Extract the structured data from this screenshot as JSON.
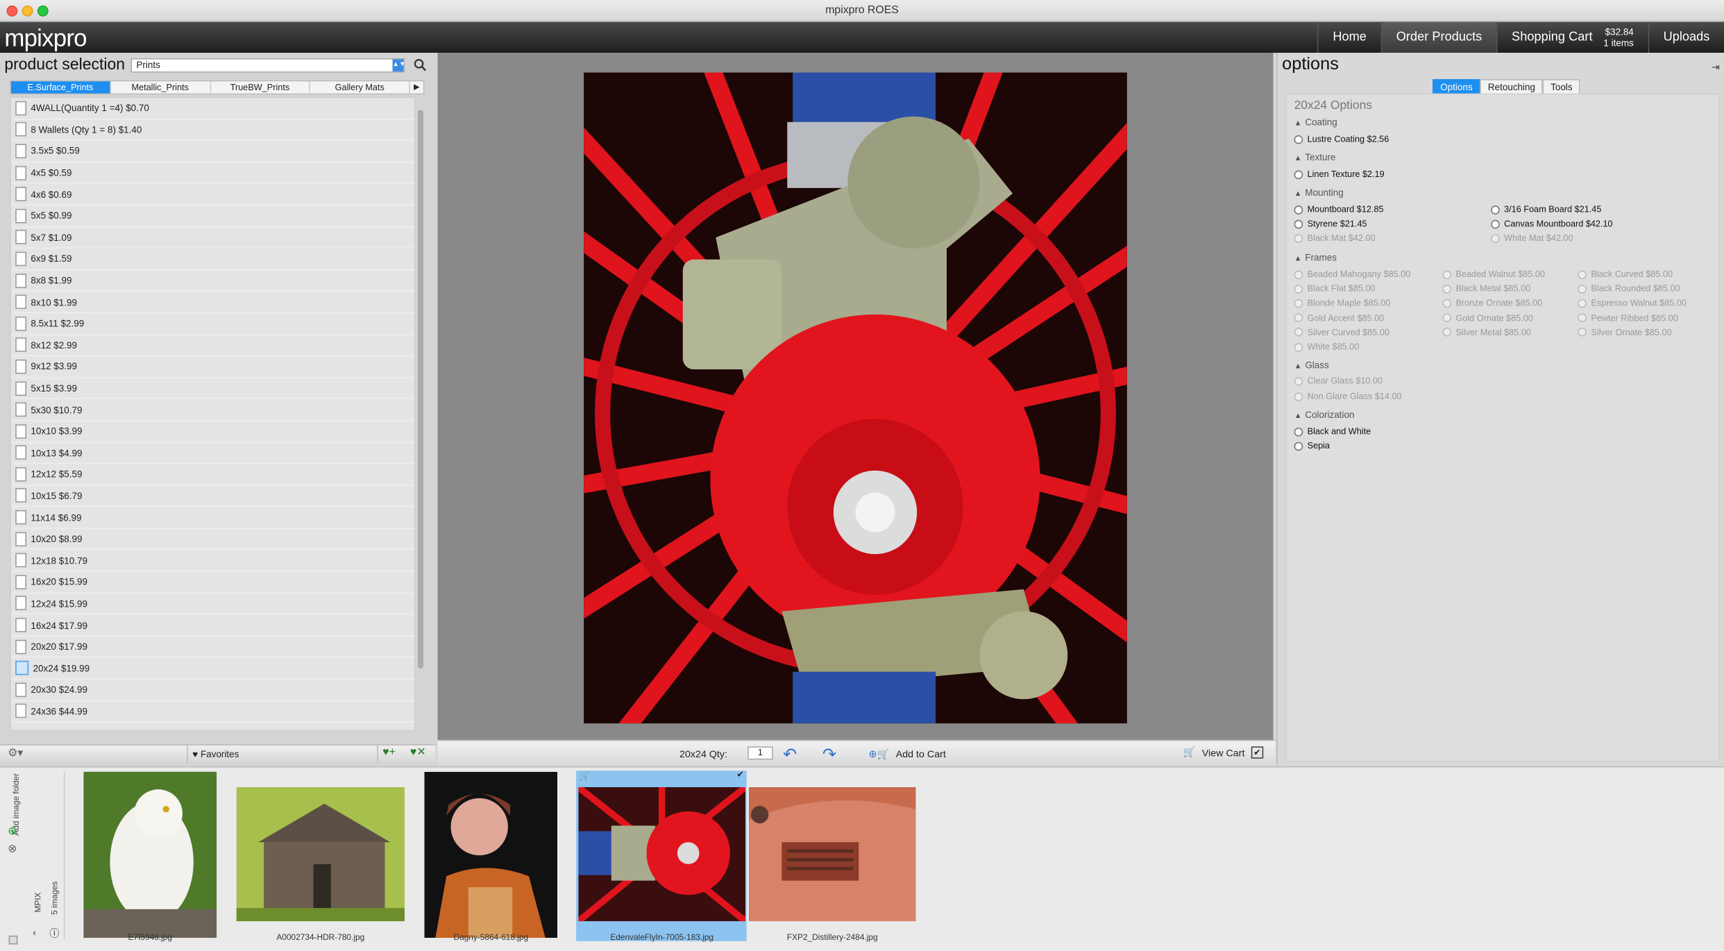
{
  "window": {
    "title": "mpixpro ROES"
  },
  "app": {
    "logo": "mpixpro",
    "nav": {
      "home": "Home",
      "order": "Order Products",
      "cart": "Shopping Cart",
      "cart_total": "$32.84",
      "cart_items": "1 items",
      "uploads": "Uploads"
    }
  },
  "product_selection": {
    "title": "product selection",
    "category": "Prints",
    "tabs": [
      "E.Surface_Prints",
      "Metallic_Prints",
      "TrueBW_Prints",
      "Gallery Mats"
    ],
    "items": [
      "4WALL(Quantity 1 =4) $0.70",
      "8 Wallets (Qty 1 = 8) $1.40",
      "3.5x5 $0.59",
      "4x5 $0.59",
      "4x6 $0.69",
      "5x5 $0.99",
      "5x7 $1.09",
      "6x9 $1.59",
      "8x8 $1.99",
      "8x10 $1.99",
      "8.5x11 $2.99",
      "8x12 $2.99",
      "9x12 $3.99",
      "5x15 $3.99",
      "5x30 $10.79",
      "10x10 $3.99",
      "10x13 $4.99",
      "12x12 $5.59",
      "10x15 $6.79",
      "11x14 $6.99",
      "10x20 $8.99",
      "12x18 $10.79",
      "16x20 $15.99",
      "12x24 $15.99",
      "16x24 $17.99",
      "20x20 $17.99",
      "20x24 $19.99",
      "20x30 $24.99",
      "24x36 $44.99"
    ],
    "selected": "20x24 $19.99",
    "favorites": "Favorites"
  },
  "order_controls": {
    "qty_label": "20x24 Qty:",
    "qty_value": "1",
    "add_to_cart": "Add to Cart",
    "view_cart": "View Cart"
  },
  "options": {
    "title": "options",
    "tabs": [
      "Options",
      "Retouching",
      "Tools"
    ],
    "size_title": "20x24 Options",
    "sections": {
      "coating": "Coating",
      "texture": "Texture",
      "mounting": "Mounting",
      "frames": "Frames",
      "glass": "Glass",
      "colorization": "Colorization"
    },
    "coating": [
      "Lustre Coating $2.56"
    ],
    "texture": [
      "Linen Texture $2.19"
    ],
    "mounting": [
      "Mountboard $12.85",
      "3/16 Foam Board $21.45",
      "Styrene $21.45",
      "Canvas Mountboard $42.10",
      "Black Mat $42.00",
      "White Mat $42.00"
    ],
    "frames": [
      "Beaded Mahogany $85.00",
      "Beaded Walnut $85.00",
      "Black Curved $85.00",
      "Black Flat $85.00",
      "Black Metal $85.00",
      "Black Rounded $85.00",
      "Blonde Maple $85.00",
      "Bronze Ornate $85.00",
      "Espresso Walnut $85.00",
      "Gold Accent $85.00",
      "Gold Ornate $85.00",
      "Pewter Ribbed $85.00",
      "Silver Curved $85.00",
      "Silver Metal $85.00",
      "Silver Ornate $85.00",
      "White $85.00"
    ],
    "glass": [
      "Clear Glass $10.00",
      "Non Glare Glass $14.00"
    ],
    "colorization": [
      "Black and White",
      "Sepia"
    ]
  },
  "filmstrip": {
    "side_label": "Add image folder",
    "source": "MPIX",
    "count": "5 images",
    "images": [
      "E7I5948.jpg",
      "A0002734-HDR-780.jpg",
      "Dagny-5864-618.jpg",
      "EdenvaleFlyIn-7005-183.jpg",
      "FXP2_Distillery-2484.jpg"
    ]
  },
  "colors": {
    "accent": "#1e8ef0",
    "header_dark": "#2a2a2a"
  }
}
